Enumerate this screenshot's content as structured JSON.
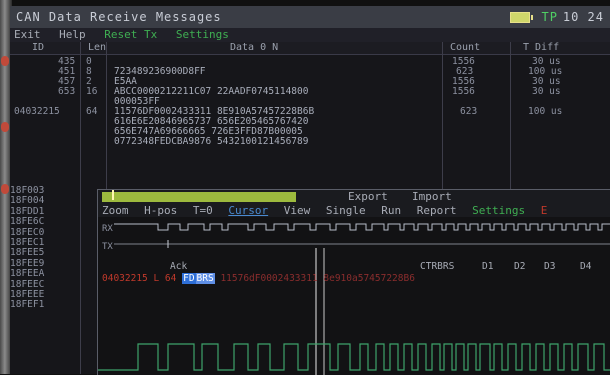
{
  "window": {
    "title": "CAN Data Receive Messages",
    "tp_label": "TP",
    "clock": "10 24"
  },
  "menu": {
    "exit": "Exit",
    "help": "Help",
    "reset": "Reset Tx",
    "settings": "Settings"
  },
  "columns": {
    "id": "ID",
    "len": "Len",
    "data": "Data 0 N",
    "count": "Count",
    "tdiff": "T Diff"
  },
  "rows": [
    {
      "id": "435",
      "len": "0",
      "data": "",
      "count": "1556",
      "tdiff": "30 us"
    },
    {
      "id": "451",
      "len": "8",
      "data": "723489236900D8FF",
      "count": "623",
      "tdiff": "100 us"
    },
    {
      "id": "457",
      "len": "2",
      "data": "E5AA",
      "count": "1556",
      "tdiff": "30 us"
    },
    {
      "id": "653",
      "len": "16",
      "data": "ABCC0000212211C07 22AADF0745114800",
      "count": "1556",
      "tdiff": "30 us"
    },
    {
      "id": "",
      "len": "",
      "data": "000053FF",
      "count": "",
      "tdiff": ""
    },
    {
      "id": "04032215",
      "len": "64",
      "data": "11576DF0002433311 8E910A57457228B6B",
      "count": "623",
      "tdiff": "100 us"
    },
    {
      "id": "",
      "len": "",
      "data": "616E6E20846965737 656E205465767420",
      "count": "",
      "tdiff": ""
    },
    {
      "id": "",
      "len": "",
      "data": "656E747A69666665 726E3FFD87B00005",
      "count": "",
      "tdiff": ""
    },
    {
      "id": "",
      "len": "",
      "data": "0772348FEDCBA9876 5432100121456789",
      "count": "",
      "tdiff": ""
    }
  ],
  "id_list": [
    "18F003",
    "18F004",
    "18FDD1",
    "18FE6C",
    "18FEC0",
    "18FEC1",
    "18FEE5",
    "18FEE9",
    "18FEEA",
    "18FEEC",
    "18FEEE",
    "18FEF1"
  ],
  "scope": {
    "export": "Export",
    "import": "Import",
    "menu": [
      "Zoom",
      "H-pos",
      "T=0",
      "Cursor",
      "View",
      "Single",
      "Run",
      "Report",
      "Settings",
      "E"
    ],
    "rx": "RX",
    "tx": "TX",
    "ack": "Ack",
    "fields": [
      "CTRBRS",
      "D1",
      "D2",
      "D3",
      "D4"
    ],
    "frame_id": "04032215 L 64",
    "fd": "FD",
    "brs": "BRS",
    "frame_data": "11576dF0002433311 8e910a57457228B6"
  }
}
